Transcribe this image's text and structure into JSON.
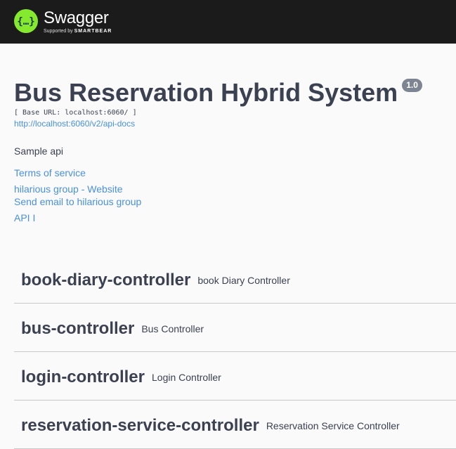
{
  "topbar": {
    "logo_icon": "swagger-braces-icon",
    "title": "Swagger",
    "subtitle_prefix": "Supported by",
    "subtitle_brand": "SMARTBEAR",
    "colors": {
      "background": "#1b1b1b",
      "logo": "#85ea2d"
    }
  },
  "info": {
    "title": "Bus Reservation Hybrid System",
    "version": "1.0",
    "base_url": "[ Base URL: localhost:6060/ ]",
    "api_docs_link": "http://localhost:6060/v2/api-docs",
    "description": "Sample api",
    "terms_of_service": "Terms of service",
    "contact_website": "hilarious group - Website",
    "contact_email": "Send email to hilarious group",
    "license": "API I"
  },
  "tags": [
    {
      "name": "book-diary-controller",
      "description": "book Diary Controller"
    },
    {
      "name": "bus-controller",
      "description": "Bus Controller"
    },
    {
      "name": "login-controller",
      "description": "Login Controller"
    },
    {
      "name": "reservation-service-controller",
      "description": "Reservation Service Controller"
    }
  ],
  "colors": {
    "link": "#4990e2",
    "text": "#3b4151",
    "version_badge": "#7d8492"
  }
}
